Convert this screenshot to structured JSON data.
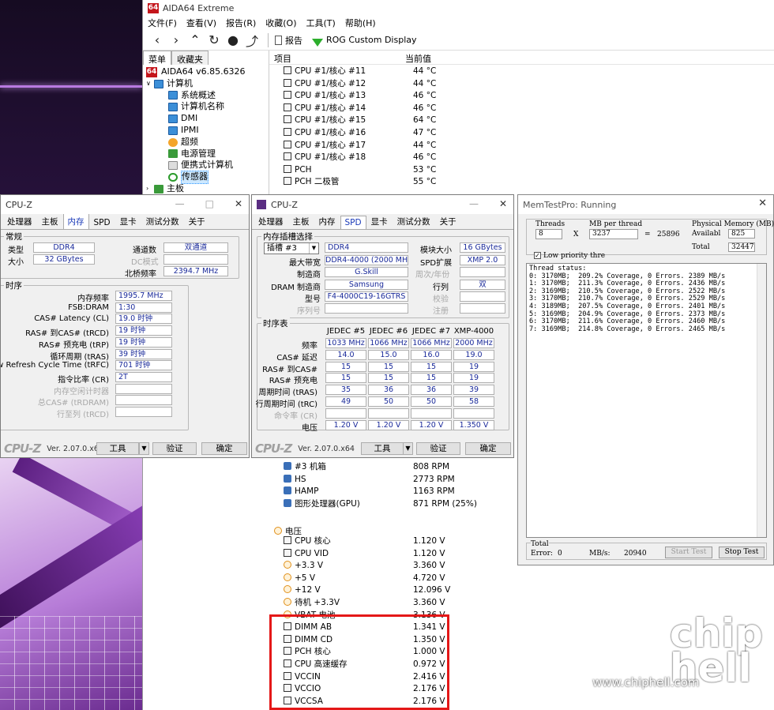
{
  "aida": {
    "title": "AIDA64 Extreme",
    "logo": "64",
    "menu": [
      "文件(F)",
      "查看(V)",
      "报告(R)",
      "收藏(O)",
      "工具(T)",
      "帮助(H)"
    ],
    "toolbar": {
      "report": "报告",
      "rog": "ROG Custom Display"
    },
    "tree_tabs": [
      "菜单",
      "收藏夹"
    ],
    "tree": [
      "AIDA64 v6.85.6326",
      "计算机",
      "系统概述",
      "计算机名称",
      "DMI",
      "IPMI",
      "超频",
      "电源管理",
      "便携式计算机",
      "传感器",
      "主板"
    ],
    "list_headers": [
      "项目",
      "当前值"
    ],
    "top_rows": [
      {
        "name": "CPU #1/核心 #11",
        "value": "44 °C"
      },
      {
        "name": "CPU #1/核心 #12",
        "value": "44 °C"
      },
      {
        "name": "CPU #1/核心 #13",
        "value": "46 °C"
      },
      {
        "name": "CPU #1/核心 #14",
        "value": "46 °C"
      },
      {
        "name": "CPU #1/核心 #15",
        "value": "64 °C"
      },
      {
        "name": "CPU #1/核心 #16",
        "value": "47 °C"
      },
      {
        "name": "CPU #1/核心 #17",
        "value": "44 °C"
      },
      {
        "name": "CPU #1/核心 #18",
        "value": "46 °C"
      },
      {
        "name": "PCH",
        "value": "53 °C"
      },
      {
        "name": "PCH 二极管",
        "value": "55 °C"
      }
    ],
    "fan_rows": [
      {
        "name": "#3 机箱",
        "value": "808 RPM"
      },
      {
        "name": "HS",
        "value": "2773 RPM"
      },
      {
        "name": "HAMP",
        "value": "1163 RPM"
      },
      {
        "name": "图形处理器(GPU)",
        "value": "871 RPM  (25%)"
      }
    ],
    "voltage_header": "电压",
    "volt_rows": [
      {
        "name": "CPU 核心",
        "value": "1.120 V",
        "icon": "chip"
      },
      {
        "name": "CPU VID",
        "value": "1.120 V",
        "icon": "chip"
      },
      {
        "name": "+3.3 V",
        "value": "3.360 V",
        "icon": "bolt"
      },
      {
        "name": "+5 V",
        "value": "4.720 V",
        "icon": "bolt"
      },
      {
        "name": "+12 V",
        "value": "12.096 V",
        "icon": "bolt"
      },
      {
        "name": "待机 +3.3V",
        "value": "3.360 V",
        "icon": "bolt"
      },
      {
        "name": "VBAT 电池",
        "value": "3.136 V",
        "icon": "bolt"
      },
      {
        "name": "DIMM AB",
        "value": "1.341 V",
        "icon": "chip"
      },
      {
        "name": "DIMM CD",
        "value": "1.350 V",
        "icon": "chip"
      },
      {
        "name": "PCH 核心",
        "value": "1.000 V",
        "icon": "chip"
      },
      {
        "name": "CPU 高速缓存",
        "value": "0.972 V",
        "icon": "chip"
      },
      {
        "name": "VCCIN",
        "value": "2.416 V",
        "icon": "chip"
      },
      {
        "name": "VCCIO",
        "value": "2.176 V",
        "icon": "chip"
      },
      {
        "name": "VCCSA",
        "value": "2.176 V",
        "icon": "chip"
      }
    ]
  },
  "cpuz1": {
    "title": "CPU-Z",
    "tabs": [
      "处理器",
      "主板",
      "内存",
      "SPD",
      "显卡",
      "测试分数",
      "关于"
    ],
    "active_tab": "内存",
    "general": "常规",
    "type_label": "类型",
    "type": "DDR4",
    "size_label": "大小",
    "size": "32 GBytes",
    "channel_label": "通道数",
    "channel": "双通道",
    "dc_label": "DC模式",
    "nb_label": "北桥频率",
    "nb": "2394.7 MHz",
    "timing": "时序",
    "rows": [
      {
        "label": "内存频率",
        "value": "1995.7 MHz"
      },
      {
        "label": "FSB:DRAM",
        "value": "1:30"
      },
      {
        "label": "CAS# Latency (CL)",
        "value": "19.0 时钟"
      },
      {
        "label": "RAS# 到CAS# (tRCD)",
        "value": "19 时钟"
      },
      {
        "label": "RAS# 预充电 (tRP)",
        "value": "19 时钟"
      },
      {
        "label": "循环周期 (tRAS)",
        "value": "39 时钟"
      },
      {
        "label": "Row Refresh Cycle Time (tRFC)",
        "value": "701 时钟"
      },
      {
        "label": "指令比率 (CR)",
        "value": "2T"
      }
    ],
    "dim_rows": [
      "内存空闲计时器",
      "总CAS# (tRDRAM)",
      "行至列 (tRCD)"
    ],
    "logo": "CPU-Z",
    "ver": "Ver. 2.07.0.x64",
    "tools": "工具",
    "validate": "验证",
    "ok": "确定"
  },
  "cpuz2": {
    "title": "CPU-Z",
    "tabs": [
      "处理器",
      "主板",
      "内存",
      "SPD",
      "显卡",
      "测试分数",
      "关于"
    ],
    "active_tab": "SPD",
    "slot_group": "内存插槽选择",
    "slot": "插槽 #3",
    "module_type": "DDR4",
    "module_size_label": "模块大小",
    "module_size": "16 GBytes",
    "bw_label": "最大带宽",
    "bw": "DDR4-4000 (2000 MHz)",
    "spd_ext_label": "SPD扩展",
    "spd_ext": "XMP 2.0",
    "mfr_label": "制造商",
    "mfr": "G.Skill",
    "week_label": "周次/年份",
    "dram_mfr_label": "DRAM 制造商",
    "dram_mfr": "Samsung",
    "rank_label": "行列",
    "rank": "双",
    "part_label": "型号",
    "part": "F4-4000C19-16GTRS",
    "check_label": "校验",
    "serial_label": "序列号",
    "reg_label": "注册",
    "timing_group": "时序表",
    "cols": [
      "JEDEC #5",
      "JEDEC #6",
      "JEDEC #7",
      "XMP-4000"
    ],
    "rows": [
      {
        "label": "频率",
        "vals": [
          "1033 MHz",
          "1066 MHz",
          "1066 MHz",
          "2000 MHz"
        ]
      },
      {
        "label": "CAS# 延迟",
        "vals": [
          "14.0",
          "15.0",
          "16.0",
          "19.0"
        ]
      },
      {
        "label": "RAS# 到CAS#",
        "vals": [
          "15",
          "15",
          "15",
          "19"
        ]
      },
      {
        "label": "RAS# 预充电",
        "vals": [
          "15",
          "15",
          "15",
          "19"
        ]
      },
      {
        "label": "周期时间 (tRAS)",
        "vals": [
          "35",
          "36",
          "36",
          "39"
        ]
      },
      {
        "label": "行周期时间 (tRC)",
        "vals": [
          "49",
          "50",
          "50",
          "58"
        ]
      },
      {
        "label": "命令率 (CR)",
        "vals": [
          "",
          "",
          "",
          ""
        ]
      },
      {
        "label": "电压",
        "vals": [
          "1.20 V",
          "1.20 V",
          "1.20 V",
          "1.350 V"
        ]
      }
    ],
    "logo": "CPU-Z",
    "ver": "Ver. 2.07.0.x64",
    "tools": "工具",
    "validate": "验证",
    "ok": "确定"
  },
  "memtest": {
    "title": "MemTestPro: Running",
    "threads_label": "Threads",
    "threads": "8",
    "x": "X",
    "mb_label": "MB per thread",
    "mb": "3237",
    "eq": "=",
    "total_mb": "25896",
    "phys_label": "Physical Memory (MB)",
    "avail_label": "Availabl",
    "avail": "825",
    "total_label": "Total",
    "total": "32447",
    "low_priority": "Low priority thre",
    "status": "Thread status:\n0: 3170MB;  209.2% Coverage, 0 Errors. 2389 MB/s\n1: 3170MB;  211.3% Coverage, 0 Errors. 2436 MB/s\n2: 3169MB;  210.5% Coverage, 0 Errors. 2522 MB/s\n3: 3170MB;  210.7% Coverage, 0 Errors. 2529 MB/s\n4: 3189MB;  207.5% Coverage, 0 Errors. 2401 MB/s\n5: 3169MB;  204.9% Coverage, 0 Errors. 2373 MB/s\n6: 3170MB;  211.6% Coverage, 0 Errors. 2460 MB/s\n7: 3169MB;  214.8% Coverage, 0 Errors. 2465 MB/s",
    "total_group": "Total",
    "error_label": "Error:",
    "error": "0",
    "mbs_label": "MB/s:",
    "mbs": "20940",
    "start": "Start Test",
    "stop": "Stop Test"
  },
  "watermark": {
    "logo": "chip\nhell",
    "url": "www.chiphell.com"
  }
}
